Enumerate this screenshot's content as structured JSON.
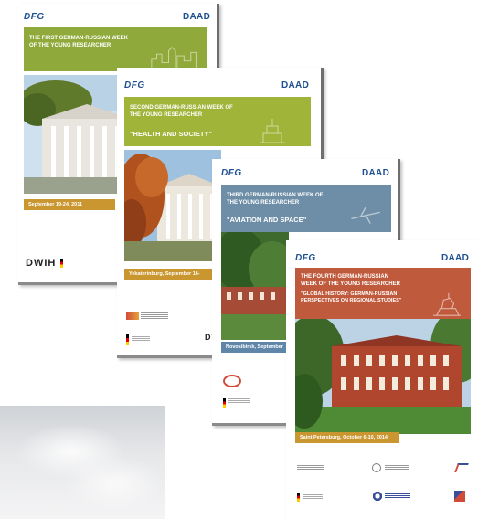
{
  "posters": [
    {
      "dfg": "DFG",
      "daad": "DAAD",
      "title": "THE FIRST GERMAN-RUSSIAN WEEK OF THE YOUNG RESEARCHER",
      "date": "September 19-24, 2011",
      "footer": "DWIH"
    },
    {
      "dfg": "DFG",
      "daad": "DAAD",
      "title": "SECOND GERMAN-RUSSIAN WEEK OF THE YOUNG RESEARCHER",
      "subtitle": "\"HEALTH AND SOCIETY\"",
      "date": "Yekaterinburg, September 16-",
      "footer": "DW"
    },
    {
      "dfg": "DFG",
      "daad": "DAAD",
      "title": "THIRD GERMAN-RUSSIAN WEEK OF THE YOUNG RESEARCHER",
      "subtitle": "\"AVIATION AND SPACE\"",
      "date": "Novosibirsk, September"
    },
    {
      "dfg": "DFG",
      "daad": "DAAD",
      "title": "THE FOURTH GERMAN-RUSSIAN WEEK OF THE YOUNG RESEARCHER",
      "subtitle": "\"GLOBAL HISTORY: GERMAN-RUSSIAN PERSPECTIVES ON REGIONAL STUDIES\"",
      "date": "Saint Petersburg, October 6-10, 2014"
    }
  ],
  "colors": {
    "dfg_blue": "#1d4f91",
    "poster1_band": "#8faa3b",
    "poster2_band": "#a0b43a",
    "poster3_band": "#6d8ea6",
    "poster4_band": "#c05a3c",
    "date_bar": "#c9962f"
  }
}
